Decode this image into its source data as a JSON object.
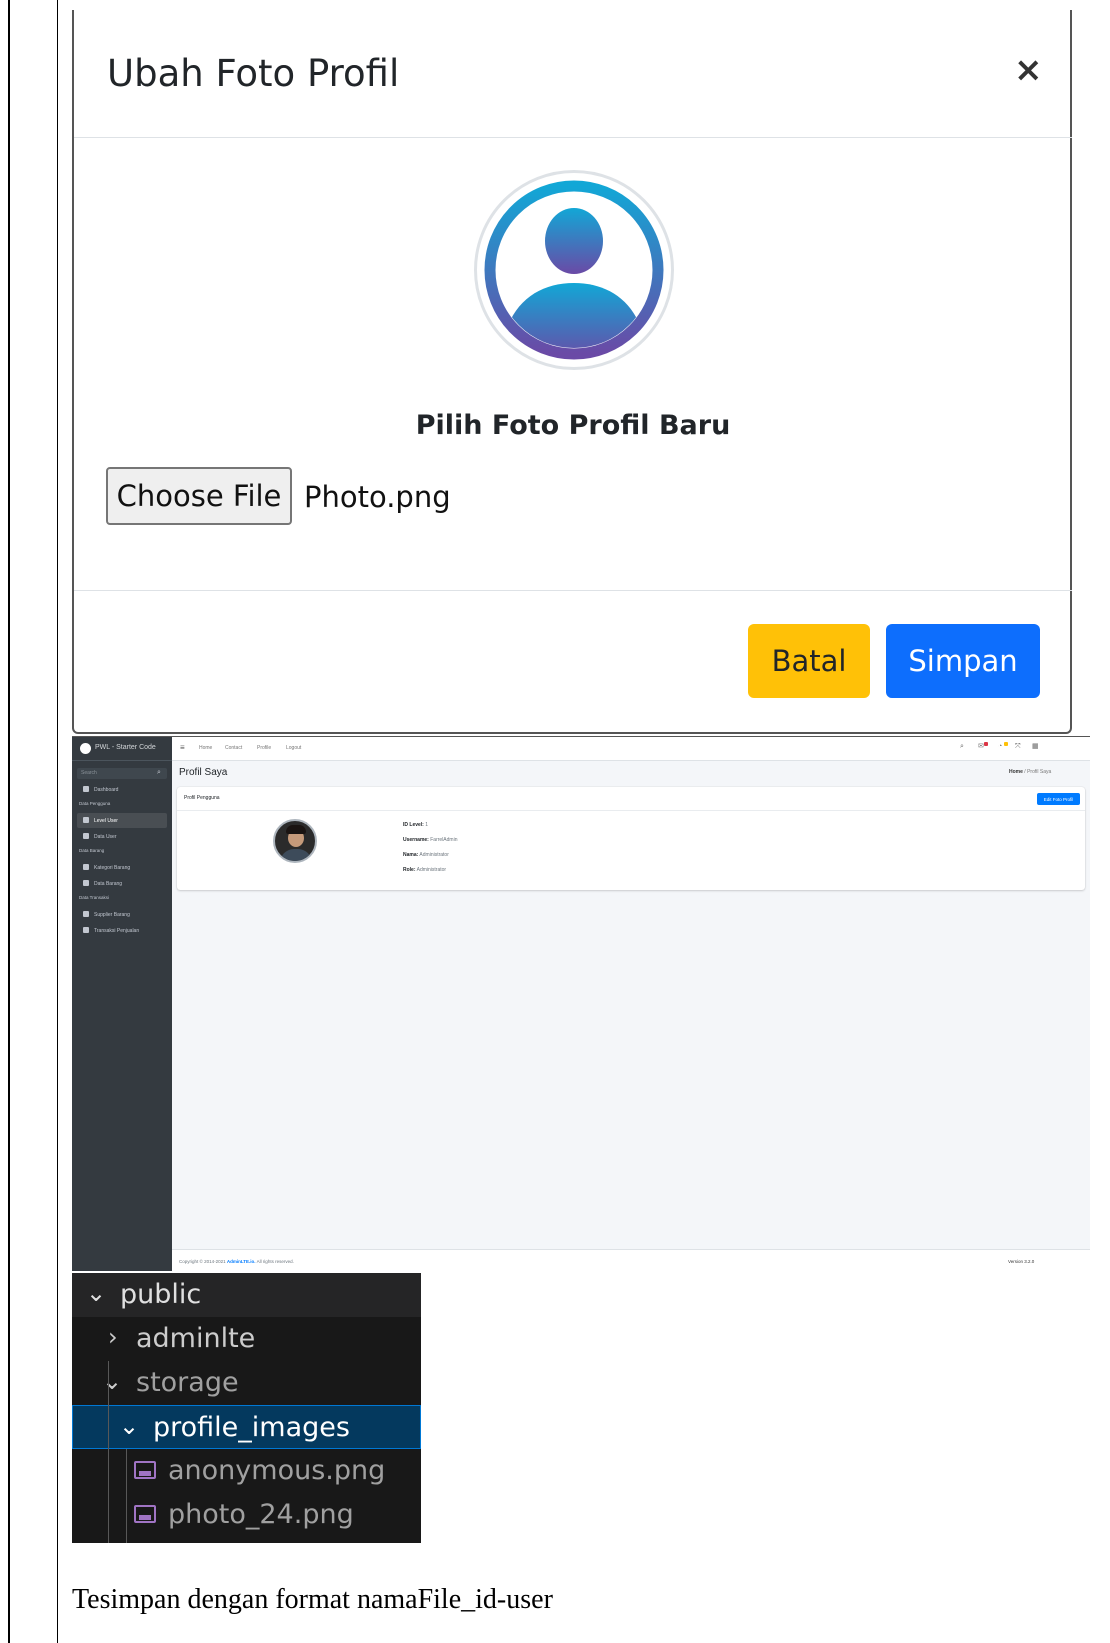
{
  "modal": {
    "title": "Ubah Foto Profil",
    "close": "×",
    "subtitle": "Pilih Foto Profil Baru",
    "file_button": "Choose File",
    "file_name": "Photo.png",
    "cancel": "Batal",
    "save": "Simpan",
    "colors": {
      "cancel": "#ffc107",
      "save": "#0d6efd",
      "avatar_gradient": [
        "#12a7d6",
        "#6a4aa6"
      ]
    }
  },
  "app": {
    "brand": "PWL - Starter Code",
    "search_placeholder": "Search",
    "sidebar": {
      "dashboard": "Dashboard",
      "head_pengguna": "Data Pengguna",
      "level_user": "Level User",
      "data_user": "Data User",
      "head_barang": "Data Barang",
      "kategori_barang": "Kategori Barang",
      "data_barang": "Data Barang",
      "head_transaksi": "Data Transaksi",
      "supplier_barang": "Supplier Barang",
      "transaksi_penjualan": "Transaksi Penjualan"
    },
    "nav": {
      "home": "Home",
      "contact": "Contact",
      "profile": "Profile",
      "logout": "Logout"
    },
    "page_title": "Profil Saya",
    "breadcrumb": {
      "home": "Home",
      "sep": "/",
      "current": "Profil Saya"
    },
    "card_title": "Profil Pengguna",
    "edit_button": "Edit Foto Profil",
    "profile": {
      "id_level_label": "ID Level:",
      "id_level": "1",
      "username_label": "Username:",
      "username": "FarrelAdmin",
      "nama_label": "Nama:",
      "nama": "Administrator",
      "role_label": "Role:",
      "role": "Administrator"
    },
    "footer": {
      "copyright": "Copyright © 2014-2021",
      "brand": "AdminLTE.io.",
      "rights": "All rights reserved.",
      "version": "Version 3.2.0"
    }
  },
  "explorer": {
    "items": [
      {
        "label": "public",
        "chevron": "⌄"
      },
      {
        "label": "adminlte",
        "chevron": "›"
      },
      {
        "label": "storage",
        "chevron": "⌄"
      },
      {
        "label": "profile_images",
        "chevron": "⌄"
      },
      {
        "label": "anonymous.png",
        "icon": "image-file-icon"
      },
      {
        "label": "photo_24.png",
        "icon": "image-file-icon"
      }
    ]
  },
  "caption": "Tesimpan dengan format namaFile_id-user"
}
